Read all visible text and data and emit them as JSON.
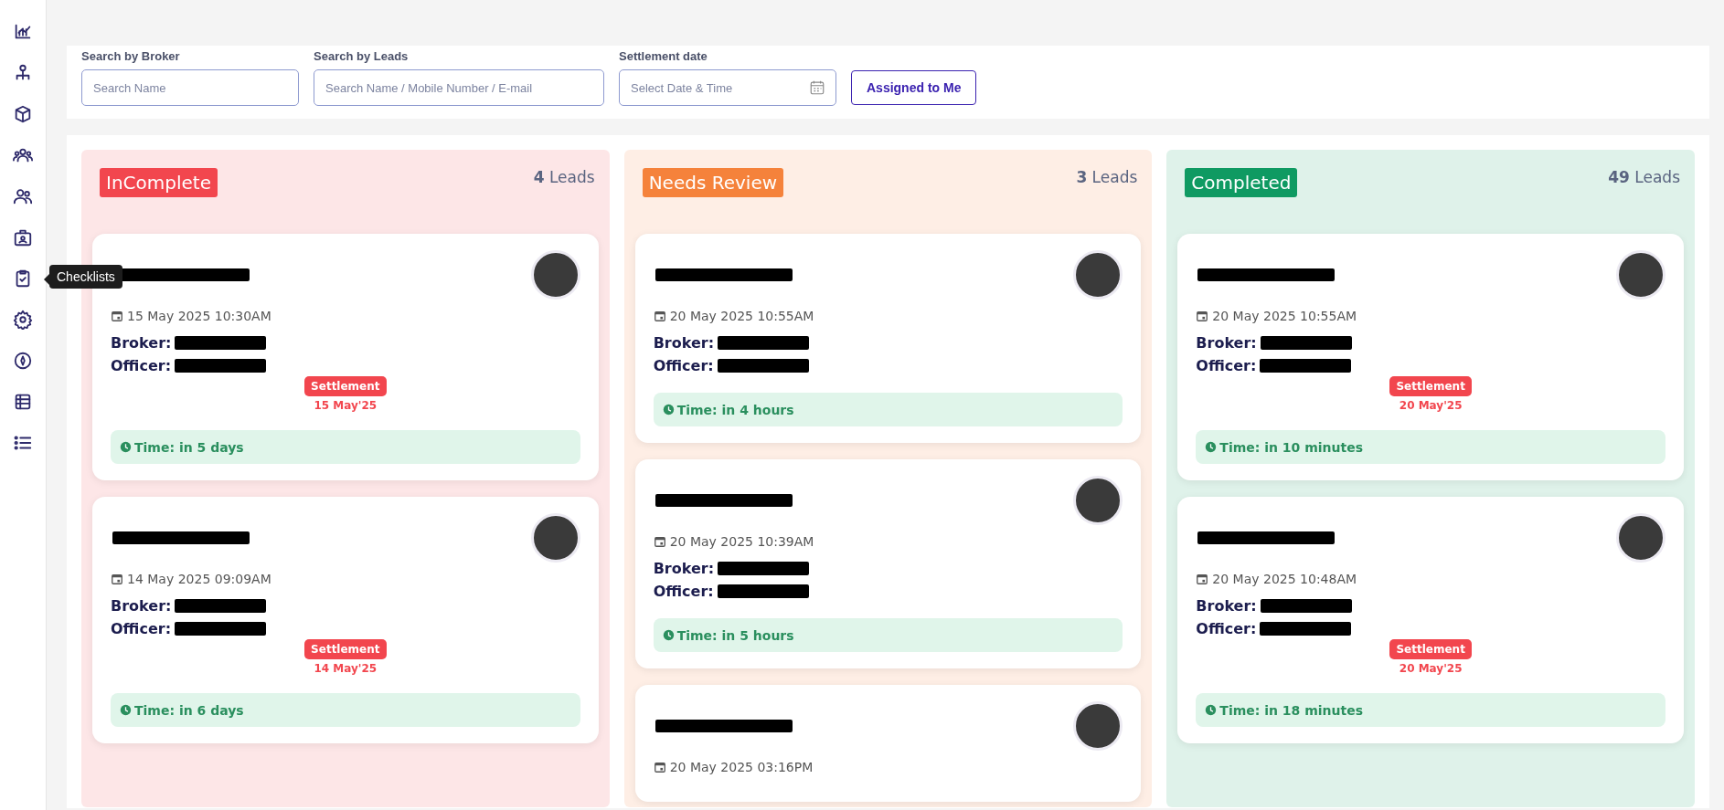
{
  "sidebar": {
    "items": [
      {
        "kind": "chart"
      },
      {
        "kind": "org"
      },
      {
        "kind": "cube"
      },
      {
        "kind": "group"
      },
      {
        "kind": "users"
      },
      {
        "kind": "idcard"
      },
      {
        "kind": "checklist",
        "tooltip": "Checklists"
      },
      {
        "kind": "gear"
      },
      {
        "kind": "compass"
      },
      {
        "kind": "table"
      },
      {
        "kind": "list"
      }
    ]
  },
  "filters": [
    {
      "kind": "text",
      "label": "Search by Broker",
      "placeholder": "Search Name"
    },
    {
      "kind": "text",
      "label": "Search by Leads",
      "placeholder": "Search Name / Mobile Number / E-mail"
    },
    {
      "kind": "date",
      "label": "Settlement date",
      "placeholder": "Select Date & Time"
    }
  ],
  "assigned_button": "Assigned to Me",
  "columns": [
    {
      "title": "InComplete",
      "color": "#f2464e",
      "count": "4",
      "count_label": "Leads",
      "cards": [
        {
          "date": "15 May 2025 10:30AM",
          "broker_label": "Broker:",
          "officer_label": "Officer:",
          "settlement": {
            "label": "Settlement",
            "date": "15 May'25"
          },
          "time_label": "Time:",
          "time": "in 5 days"
        },
        {
          "date": "14 May 2025 09:09AM",
          "broker_label": "Broker:",
          "officer_label": "Officer:",
          "settlement": {
            "label": "Settlement",
            "date": "14 May'25"
          },
          "time_label": "Time:",
          "time": "in 6 days"
        }
      ]
    },
    {
      "title": "Needs Review",
      "color": "#f5823b",
      "count": "3",
      "count_label": "Leads",
      "cards": [
        {
          "date": "20 May 2025 10:55AM",
          "broker_label": "Broker:",
          "officer_label": "Officer:",
          "time_label": "Time:",
          "time": "in 4 hours"
        },
        {
          "date": "20 May 2025 10:39AM",
          "broker_label": "Broker:",
          "officer_label": "Officer:",
          "time_label": "Time:",
          "time": "in 5 hours"
        },
        {
          "date": "20 May 2025 03:16PM"
        }
      ]
    },
    {
      "title": "Completed",
      "color": "#0f9a62",
      "count": "49",
      "count_label": "Leads",
      "cards": [
        {
          "date": "20 May 2025 10:55AM",
          "broker_label": "Broker:",
          "officer_label": "Officer:",
          "settlement": {
            "label": "Settlement",
            "date": "20 May'25"
          },
          "time_label": "Time:",
          "time": "in 10 minutes"
        },
        {
          "date": "20 May 2025 10:48AM",
          "broker_label": "Broker:",
          "officer_label": "Officer:",
          "settlement": {
            "label": "Settlement",
            "date": "20 May'25"
          },
          "time_label": "Time:",
          "time": "in 18 minutes"
        }
      ]
    }
  ]
}
